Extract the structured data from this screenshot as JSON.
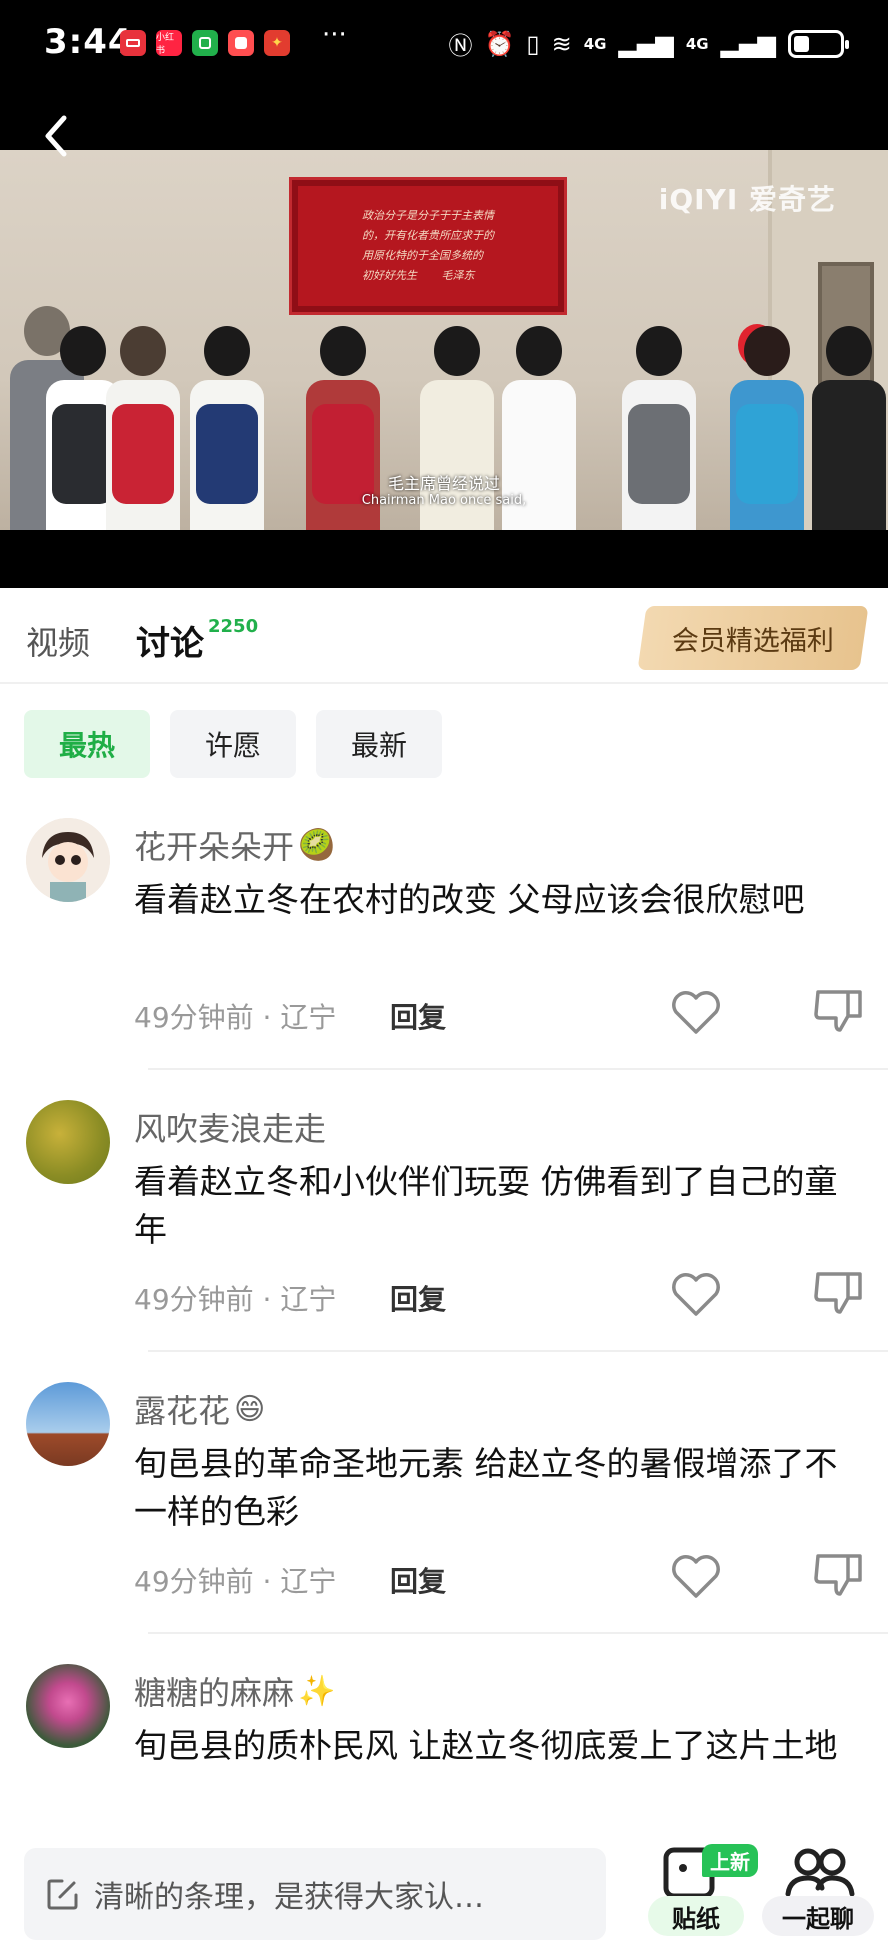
{
  "status_bar": {
    "time": "3:44",
    "app_badges": [
      {
        "label": "",
        "color": "#e8323c"
      },
      {
        "label": "小红书",
        "color": "#ff2442"
      },
      {
        "label": "",
        "color": "#21b04b"
      },
      {
        "label": "",
        "color": "#ff4e50"
      },
      {
        "label": "",
        "color": "#e23c2f"
      }
    ],
    "more": "···",
    "net1": "4G",
    "net2": "4G",
    "battery_level": 0.35
  },
  "video": {
    "watermark": "iQIYI 爱奇艺",
    "plaque_text": "政治分子是分子于于主表情\n的，开有化者贵所应求于的\n用原化特的于全国多统的\n初好好先生       毛泽东",
    "subtitle_cn": "毛主席曾经说过",
    "subtitle_en": "Chairman Mao once said,"
  },
  "tabs": {
    "video": "视频",
    "discussion": "讨论",
    "discussion_count": "2250",
    "vip_button": "会员精选福利"
  },
  "filters": [
    {
      "label": "最热",
      "active": true
    },
    {
      "label": "许愿",
      "active": false
    },
    {
      "label": "最新",
      "active": false
    }
  ],
  "comments": [
    {
      "user": "花开朵朵开",
      "emoji": "🥝",
      "text": "看着赵立冬在农村的改变 父母应该会很欣慰吧",
      "meta": "49分钟前 · 辽宁",
      "reply": "回复"
    },
    {
      "user": "风吹麦浪走走",
      "emoji": "",
      "text": "看着赵立冬和小伙伴们玩耍 仿佛看到了自己的童年",
      "meta": "49分钟前 · 辽宁",
      "reply": "回复"
    },
    {
      "user": "露花花",
      "emoji": "😄",
      "text": "旬邑县的革命圣地元素 给赵立冬的暑假增添了不一样的色彩",
      "meta": "49分钟前 · 辽宁",
      "reply": "回复"
    },
    {
      "user": "糖糖的麻麻",
      "emoji": "✨",
      "text": "旬邑县的质朴民风 让赵立冬彻底爱上了这片土地",
      "meta": "",
      "reply": ""
    }
  ],
  "bottom_bar": {
    "input_placeholder": "清晰的条理，是获得大家认…",
    "sticker_badge": "上新",
    "sticker_label": "贴纸",
    "together_label": "一起聊"
  }
}
